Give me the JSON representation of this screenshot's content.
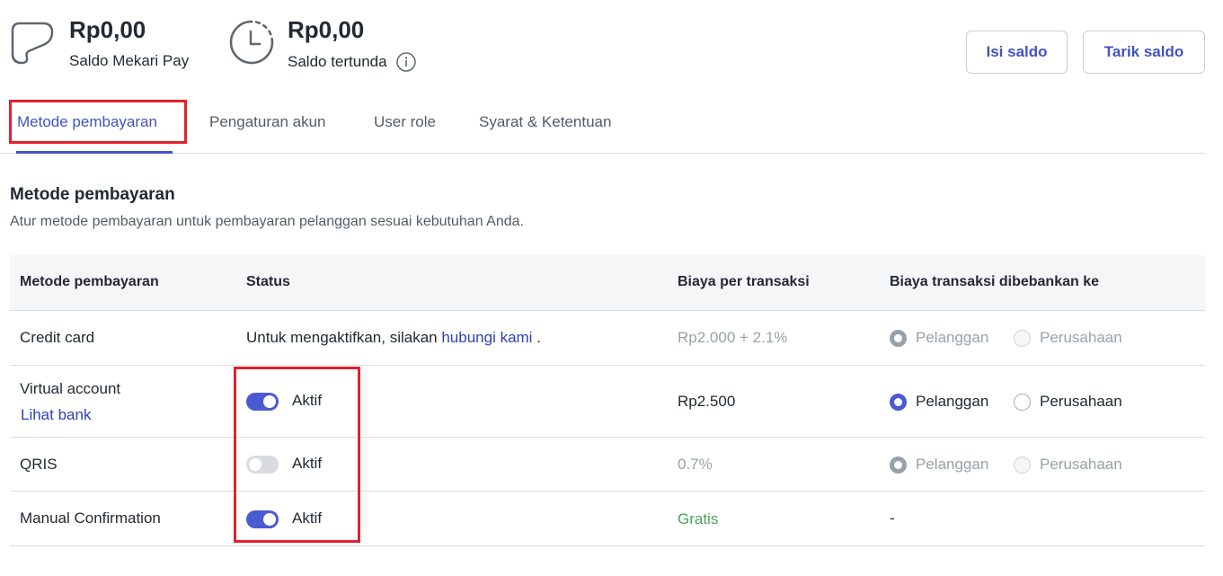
{
  "balances": {
    "mekari_pay": {
      "amount": "Rp0,00",
      "label": "Saldo Mekari Pay",
      "icon": "wallet-icon"
    },
    "pending": {
      "amount": "Rp0,00",
      "label": "Saldo tertunda",
      "icon": "clock-icon"
    }
  },
  "actions": {
    "topup": "Isi saldo",
    "withdraw": "Tarik saldo"
  },
  "tabs": [
    {
      "label": "Metode pembayaran",
      "active": true
    },
    {
      "label": "Pengaturan akun"
    },
    {
      "label": "User role"
    },
    {
      "label": "Syarat & Ketentuan"
    }
  ],
  "section": {
    "title": "Metode pembayaran",
    "description": "Atur metode pembayaran untuk pembayaran pelanggan sesuai kebutuhan Anda."
  },
  "table": {
    "headers": [
      "Metode pembayaran",
      "Status",
      "Biaya per transaksi",
      "Biaya transaksi dibebankan ke"
    ],
    "rows": [
      {
        "method": "Credit card",
        "status_text": "Untuk mengaktifkan, silakan",
        "status_link": "hubungi kami",
        "status_suffix": ".",
        "fee": "Rp2.000 + 2.1%",
        "charge_customer": "Pelanggan",
        "charge_company": "Perusahaan"
      },
      {
        "method": "Virtual account",
        "method_link": "Lihat bank",
        "toggle_on": true,
        "status_label": "Aktif",
        "fee": "Rp2.500",
        "charge_customer": "Pelanggan",
        "charge_company": "Perusahaan"
      },
      {
        "method": "QRIS",
        "toggle_on": false,
        "status_label": "Aktif",
        "fee": "0.7%",
        "charge_customer": "Pelanggan",
        "charge_company": "Perusahaan"
      },
      {
        "method": "Manual Confirmation",
        "toggle_on": true,
        "status_label": "Aktif",
        "fee": "Gratis",
        "charge_none": "-"
      }
    ]
  },
  "colors": {
    "accent": "#4253c2",
    "highlight": "#e3202e",
    "free": "#4ca35a"
  }
}
